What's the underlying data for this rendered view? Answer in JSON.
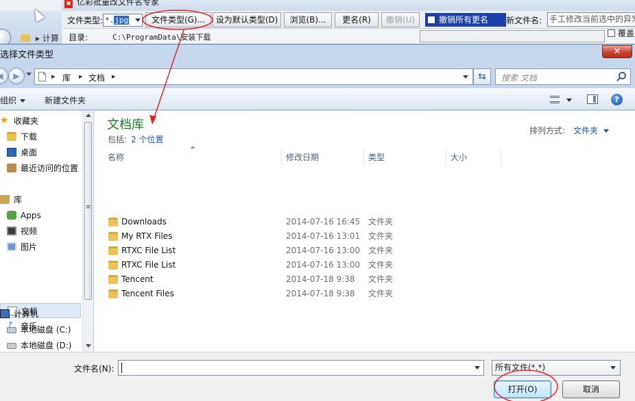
{
  "background_app": {
    "title": "亿彩批量改文件名专家",
    "explorer_crumb": "计算",
    "toolbar": {
      "file_type_label": "文件类型:",
      "file_type_value_prefix": "*.",
      "file_type_value_sel": "jpg",
      "file_type_button": "文件类型(G)...",
      "set_default_button": "设为默认类型(D)",
      "browse_button": "浏览(B)...",
      "rename_button": "更名(R)",
      "undo_button": "撤销(U)",
      "undo_all_checkbox": "撤销所有更名",
      "new_name_label": "新文件名:",
      "new_name_value": "手工修改当前选中的异常"
    },
    "dir_label": "目录:",
    "dir_value": "C:\\ProgramData\\安装下载",
    "overwrite_label": "覆盖"
  },
  "dialog": {
    "title": "选择文件类型",
    "close_glyph": "✕",
    "address": {
      "crumbs": [
        "库",
        "文档"
      ],
      "separator": "▸"
    },
    "search_placeholder": "搜索 文档",
    "commands": {
      "organize": "组织",
      "new_folder": "新建文件夹"
    },
    "help_glyph": "?",
    "nav_items": [
      {
        "label": "收藏夹",
        "icon": "star-icon"
      },
      {
        "label": "下载",
        "icon": "downloads-folder-icon"
      },
      {
        "label": "桌面",
        "icon": "desktop-icon"
      },
      {
        "label": "最近访问的位置",
        "icon": "recent-places-icon"
      },
      {
        "label": "库",
        "icon": "library-icon"
      },
      {
        "label": "Apps",
        "icon": "apps-icon"
      },
      {
        "label": "视频",
        "icon": "video-icon"
      },
      {
        "label": "图片",
        "icon": "pictures-icon"
      },
      {
        "label": "文档",
        "icon": "documents-icon",
        "selected": true
      },
      {
        "label": "音乐",
        "icon": "music-icon"
      },
      {
        "label": "计算机",
        "icon": "computer-icon"
      },
      {
        "label": "本地磁盘 (C:)",
        "icon": "disk-icon"
      },
      {
        "label": "本地磁盘 (D:)",
        "icon": "disk-icon"
      }
    ],
    "library": {
      "title": "文档库",
      "includes_label": "包括:",
      "includes_link": "2 个位置",
      "arrange_label": "排列方式:",
      "arrange_value": "文件夹"
    },
    "columns": [
      "名称",
      "修改日期",
      "类型",
      "大小"
    ],
    "files": [
      {
        "name": "Downloads",
        "date": "2014-07-16 16:45",
        "type": "文件夹"
      },
      {
        "name": "My RTX Files",
        "date": "2014-07-16 13:01",
        "type": "文件夹"
      },
      {
        "name": "RTXC File List",
        "date": "2014-07-16 13:00",
        "type": "文件夹"
      },
      {
        "name": "RTXC File List",
        "date": "2014-07-16 13:00",
        "type": "文件夹"
      },
      {
        "name": "Tencent",
        "date": "2014-07-18 9:38",
        "type": "文件夹"
      },
      {
        "name": "Tencent Files",
        "date": "2014-07-18 9:38",
        "type": "文件夹"
      }
    ],
    "file_name_label": "文件名(N):",
    "file_name_value": "",
    "file_type_filter": "所有文件(*.*)",
    "open_button": "打开(O)",
    "cancel_button": "取消"
  },
  "colors": {
    "library_title": "#1e7a28",
    "link": "#1a55b0",
    "annotation": "#e0262b",
    "close_button": "#c9432f"
  }
}
